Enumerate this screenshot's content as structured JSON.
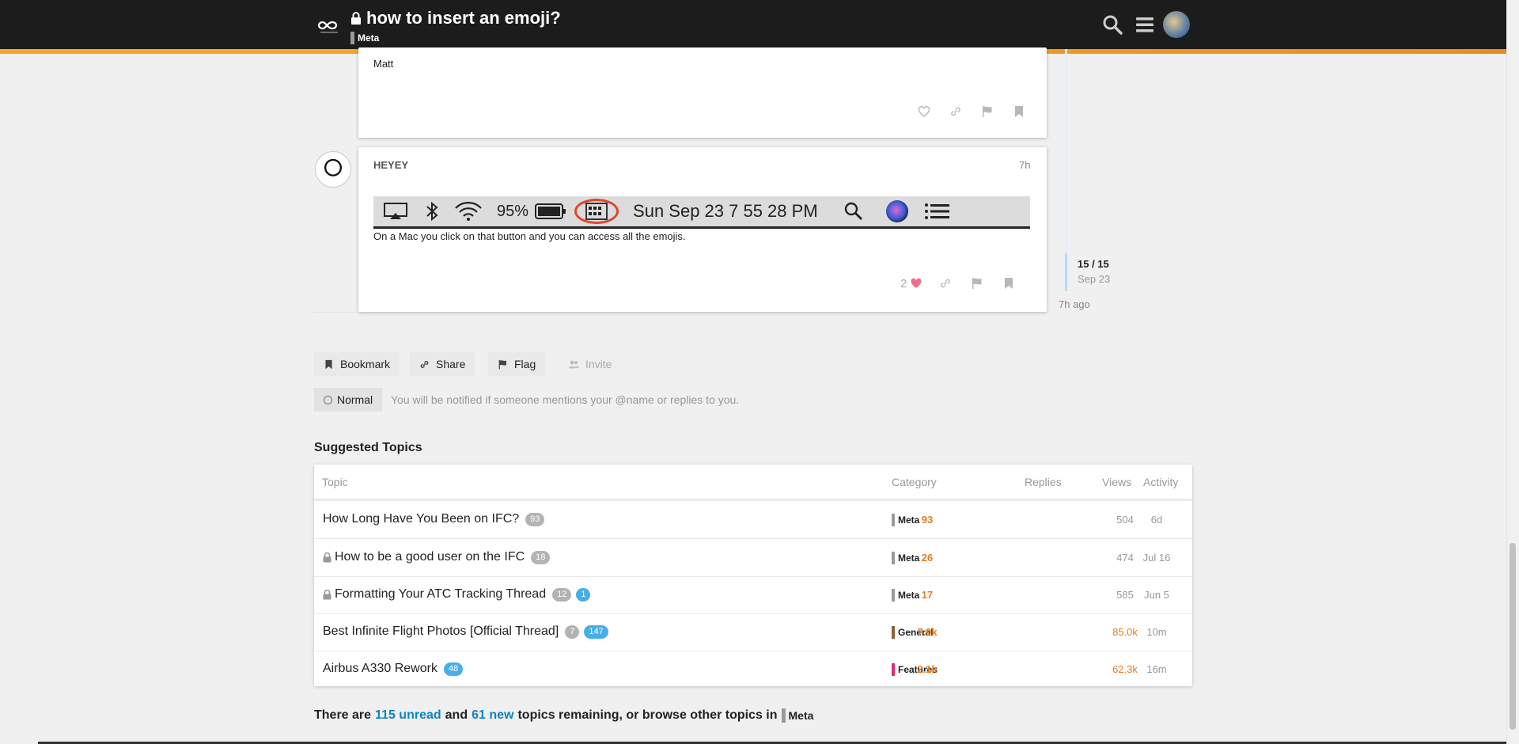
{
  "header": {
    "title": "how to insert an emoji?",
    "category": "Meta",
    "icons": [
      "logo-infinity-icon",
      "lock-icon",
      "search-icon",
      "hamburger-menu-icon"
    ]
  },
  "posts": [
    {
      "text": "Matt"
    },
    {
      "username": "HEYEY",
      "age": "7h",
      "image": {
        "battery": "95%",
        "clock": "Sun Sep 23  7 55 28 PM"
      },
      "text": "On a Mac you click on that button and you can access all the emojis.",
      "likes": "2"
    }
  ],
  "timeline": {
    "count": "15 / 15",
    "date": "Sep 23",
    "ago": "7h ago"
  },
  "footer_buttons": {
    "bookmark": "Bookmark",
    "share": "Share",
    "flag": "Flag",
    "invite": "Invite"
  },
  "notification": {
    "level": "Normal",
    "description": "You will be notified if someone mentions your @name or replies to you."
  },
  "suggested": {
    "title": "Suggested Topics",
    "columns": [
      "Topic",
      "Category",
      "Replies",
      "Views",
      "Activity"
    ],
    "rows": [
      {
        "topic": "How Long Have You Been on IFC?",
        "count": "93",
        "category": "Meta",
        "category_color": "#9a9a9a",
        "replies": "93",
        "views": "504",
        "activity": "6d"
      },
      {
        "topic": "How to be a good user on the IFC",
        "count": "18",
        "category": "Meta",
        "category_color": "#9a9a9a",
        "replies": "26",
        "views": "474",
        "activity": "Jul 16"
      },
      {
        "topic": "Formatting Your ATC Tracking Thread",
        "count": "12",
        "new": "1",
        "category": "Meta",
        "category_color": "#9a9a9a",
        "replies": "17",
        "views": "585",
        "activity": "Jun 5"
      },
      {
        "topic": "Best Infinite Flight Photos [Official Thread]",
        "count": "7",
        "new": "147",
        "category": "General",
        "category_color": "#8c6238",
        "replies": "7.9k",
        "views": "85.0k",
        "activity": "10m"
      },
      {
        "topic": "Airbus A330 Rework",
        "new": "48",
        "category": "Features",
        "category_color": "#e02a78",
        "replies": "2.1k",
        "views": "62.3k",
        "activity": "16m"
      }
    ]
  },
  "bottom": {
    "prefix": "There are",
    "unread": "115 unread",
    "and": "and",
    "new": "61 new",
    "suffix": "topics remaining, or browse other topics in",
    "category": "Meta"
  },
  "colors": {
    "accent": "#f5a623",
    "replies_hot": "#e67e22",
    "link": "#0a84c4",
    "pill_blue": "#48aee8"
  }
}
